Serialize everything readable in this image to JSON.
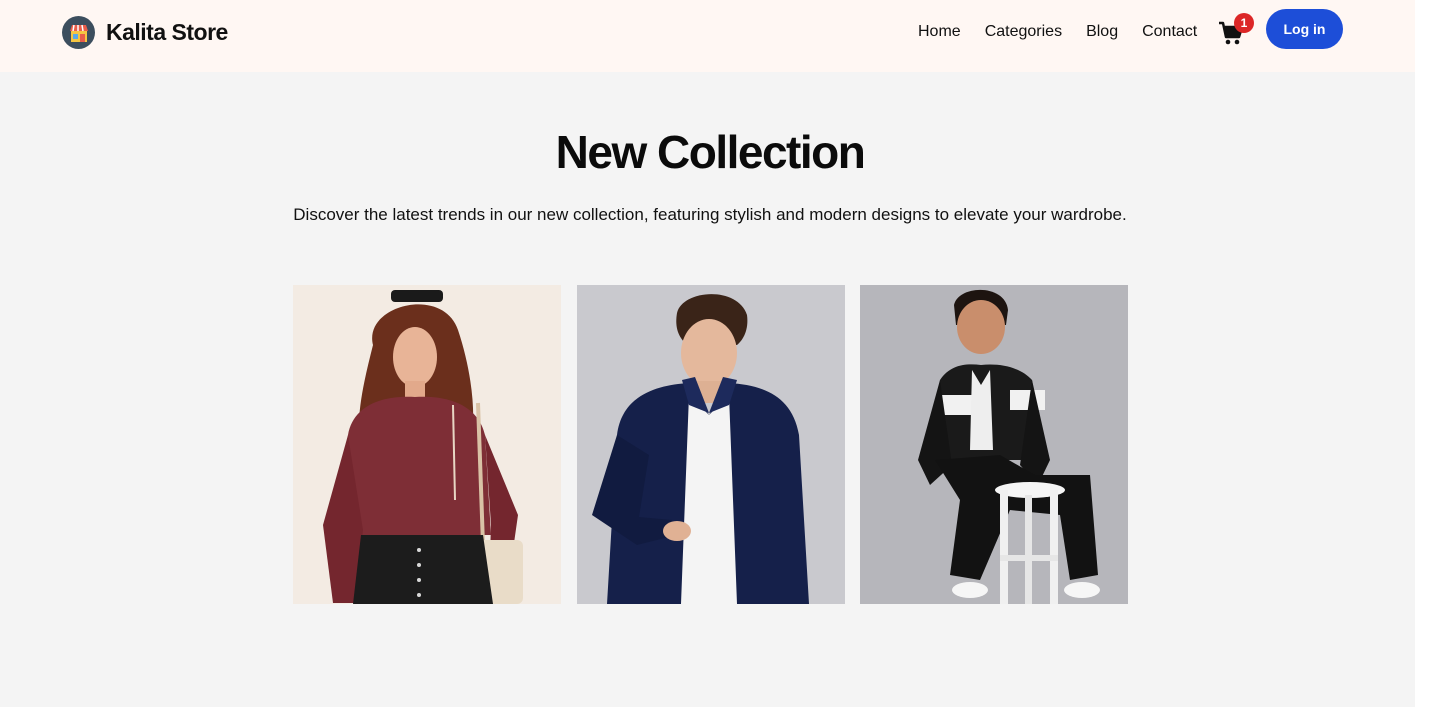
{
  "header": {
    "brand_name": "Kalita Store",
    "logo_icon": "storefront-icon",
    "nav_items": [
      {
        "label": "Home"
      },
      {
        "label": "Categories"
      },
      {
        "label": "Blog"
      },
      {
        "label": "Contact"
      }
    ],
    "cart_icon": "shopping-cart-icon",
    "cart_count": "1",
    "login_label": "Log in"
  },
  "hero": {
    "title": "New Collection",
    "subtitle": "Discover the latest trends in our new collection, featuring stylish and modern designs to elevate your wardrobe."
  },
  "colors": {
    "page_background": "#f4f4f4",
    "header_background": "#fff7f3",
    "accent": "#1d4ed8",
    "badge": "#dc2626"
  }
}
